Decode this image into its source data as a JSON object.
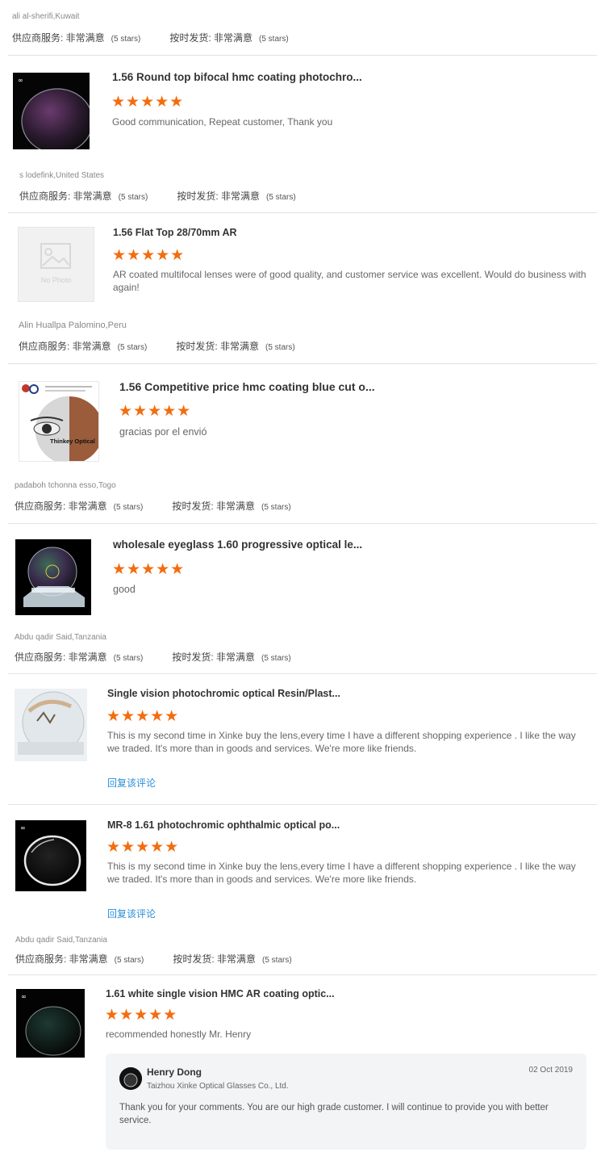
{
  "reviews": [
    {
      "reviewer": "ali al-sherifi,Kuwait",
      "supplier_label": "供应商服务: 非常满意",
      "supplier_stars": "(5 stars)",
      "ship_label": "按时发货: 非常满意",
      "ship_stars": "(5 stars)"
    },
    {
      "product": "1.56 Round top bifocal hmc coating photochro...",
      "rating": "★★★★★",
      "comment": "Good communication, Repeat customer, Thank you",
      "reviewer": "s lodefink,United States",
      "supplier_label": "供应商服务: 非常满意",
      "supplier_stars": "(5 stars)",
      "ship_label": "按时发货: 非常满意",
      "ship_stars": "(5 stars)"
    },
    {
      "product": "1.56 Flat Top 28/70mm AR",
      "rating": "★★★★★",
      "comment": "AR coated multifocal lenses were of good quality, and customer service was excellent.  Would do business with again!",
      "no_photo": "No Photo",
      "reviewer": "Alin Huallpa Palomino,Peru",
      "supplier_label": "供应商服务: 非常满意",
      "supplier_stars": "(5 stars)",
      "ship_label": "按时发货: 非常满意",
      "ship_stars": "(5 stars)"
    },
    {
      "product": "1.56 Competitive price hmc coating blue cut o...",
      "rating": "★★★★★",
      "comment": "gracias por el envió",
      "image_caption": "Thinkey Optical",
      "reviewer": "padaboh tchonna esso,Togo",
      "supplier_label": "供应商服务: 非常满意",
      "supplier_stars": "(5 stars)",
      "ship_label": "按时发货: 非常满意",
      "ship_stars": "(5 stars)"
    },
    {
      "product": "wholesale eyeglass 1.60 progressive optical le...",
      "rating": "★★★★★",
      "comment": "good",
      "reviewer": "Abdu qadir Said,Tanzania",
      "supplier_label": "供应商服务: 非常满意",
      "supplier_stars": "(5 stars)",
      "ship_label": "按时发货: 非常满意",
      "ship_stars": "(5 stars)"
    },
    {
      "product": "Single vision photochromic optical Resin/Plast...",
      "rating": "★★★★★",
      "comment": "This is my second time in Xinke  buy the lens,every time I have a different shopping experience . I like the way we traded.  It's more than in goods and services. We're more like friends.",
      "reply_link": "回复该评论"
    },
    {
      "product": "MR-8 1.61 photochromic ophthalmic optical po...",
      "rating": "★★★★★",
      "comment": "This is my second time in Xinke  buy the lens,every time I have a different shopping experience . I like the way we traded.  It's more than in goods and services. We're more like friends.",
      "reply_link": "回复该评论",
      "reviewer": "Abdu qadir Said,Tanzania",
      "supplier_label": "供应商服务: 非常满意",
      "supplier_stars": "(5 stars)",
      "ship_label": "按时发货: 非常满意",
      "ship_stars": "(5 stars)"
    },
    {
      "product": "1.61 white single vision HMC AR coating optic...",
      "rating": "★★★★★",
      "comment": "recommended honestly Mr. Henry",
      "reply": {
        "name": "Henry Dong",
        "company": "Taizhou Xinke Optical Glasses Co., Ltd.",
        "date": "02 Oct 2019",
        "text": "Thank you for your comments. You are our high grade  customer. I will continue to provide you with better service."
      }
    }
  ]
}
